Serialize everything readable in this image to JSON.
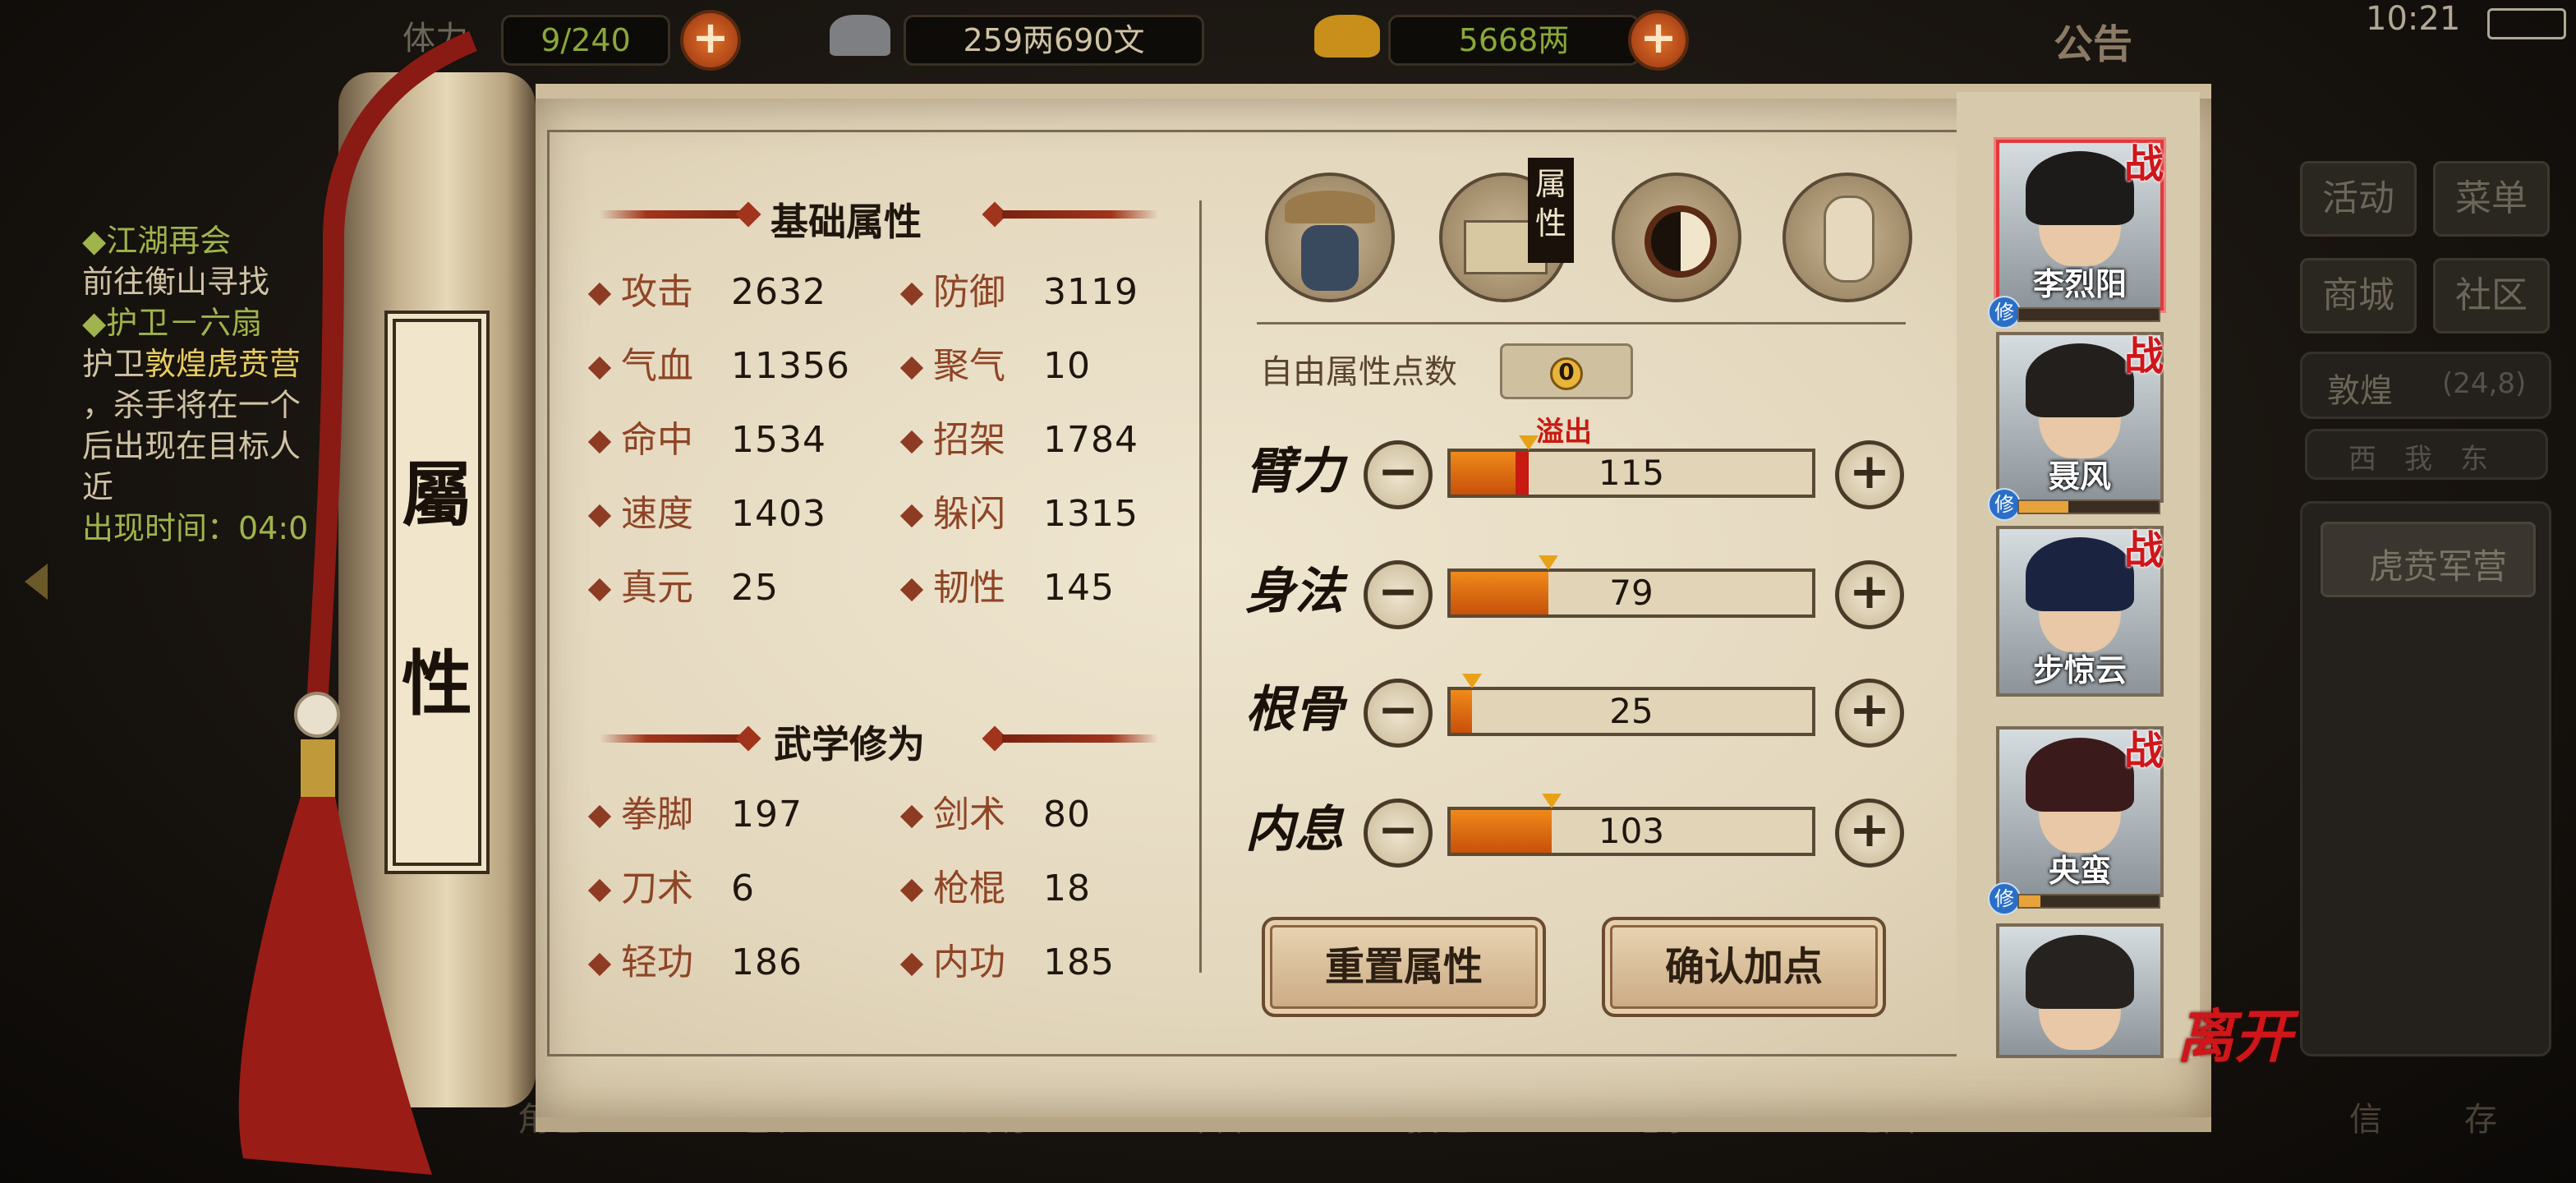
{
  "status": {
    "time": "10:21"
  },
  "top_bar": {
    "stamina_label": "体力",
    "stamina": "9/240",
    "silver": "259两690文",
    "gold": "5668两",
    "notice": "公告"
  },
  "quest": {
    "title1": "江湖再会",
    "desc1": "前往衡山寻找",
    "title2": "护卫－六扇",
    "desc2_a": "护卫",
    "desc2_hl": "敦煌虎贲营",
    "desc2_b": "，杀手将在一个",
    "desc2_c": "后出现在目标人",
    "desc2_d": "近",
    "time_label": "出现时间：04:0"
  },
  "right_menu": {
    "activity": "活动",
    "menu": "菜单",
    "mall": "商城",
    "community": "社区",
    "location": "敦煌",
    "coords": "(24,8)",
    "direction": "西　我　东",
    "camp": "虎贲军营"
  },
  "bottom_nav": [
    "角色",
    "包裹",
    "武功",
    "布阵",
    "技艺",
    "记事",
    "地图",
    "信",
    "存"
  ],
  "scroll_tab": {
    "char1": "屬",
    "char2": "性"
  },
  "base_attrs": {
    "heading": "基础属性",
    "items": [
      {
        "name": "攻击",
        "value": "2632"
      },
      {
        "name": "防御",
        "value": "3119"
      },
      {
        "name": "气血",
        "value": "11356"
      },
      {
        "name": "聚气",
        "value": "10"
      },
      {
        "name": "命中",
        "value": "1534"
      },
      {
        "name": "招架",
        "value": "1784"
      },
      {
        "name": "速度",
        "value": "1403"
      },
      {
        "name": "躲闪",
        "value": "1315"
      },
      {
        "name": "真元",
        "value": "25"
      },
      {
        "name": "韧性",
        "value": "145"
      }
    ]
  },
  "martial": {
    "heading": "武学修为",
    "items": [
      {
        "name": "拳脚",
        "value": "197"
      },
      {
        "name": "剑术",
        "value": "80"
      },
      {
        "name": "刀术",
        "value": "6"
      },
      {
        "name": "枪棍",
        "value": "18"
      },
      {
        "name": "轻功",
        "value": "186"
      },
      {
        "name": "内功",
        "value": "185"
      }
    ]
  },
  "tabs": {
    "selected_label": "属性"
  },
  "free_points": {
    "label": "自由属性点数",
    "value": "0"
  },
  "overflow_label": "溢出",
  "attributes": [
    {
      "name": "臂力",
      "value": "115",
      "fill": 0.18,
      "overflow": 0.035
    },
    {
      "name": "身法",
      "value": "79",
      "fill": 0.27
    },
    {
      "name": "根骨",
      "value": "25",
      "fill": 0.06
    },
    {
      "name": "内息",
      "value": "103",
      "fill": 0.28
    }
  ],
  "buttons": {
    "reset": "重置属性",
    "confirm": "确认加点"
  },
  "heroes": [
    {
      "name": "李烈阳",
      "battle": "战",
      "xiu": "修",
      "progress": 0.0
    },
    {
      "name": "聂风",
      "battle": "战",
      "xiu": "修",
      "progress": 0.35
    },
    {
      "name": "步惊云",
      "battle": "战",
      "xiu": "",
      "progress": 0.0
    },
    {
      "name": "央蛮",
      "battle": "战",
      "xiu": "修",
      "progress": 0.15
    },
    {
      "name": "",
      "battle": "",
      "xiu": "",
      "progress": 0.0
    }
  ],
  "leave": "离开",
  "colors": {
    "accent_red": "#d0161a",
    "bar_orange": "#ef8a1a",
    "parchment": "#e3d7bd"
  }
}
